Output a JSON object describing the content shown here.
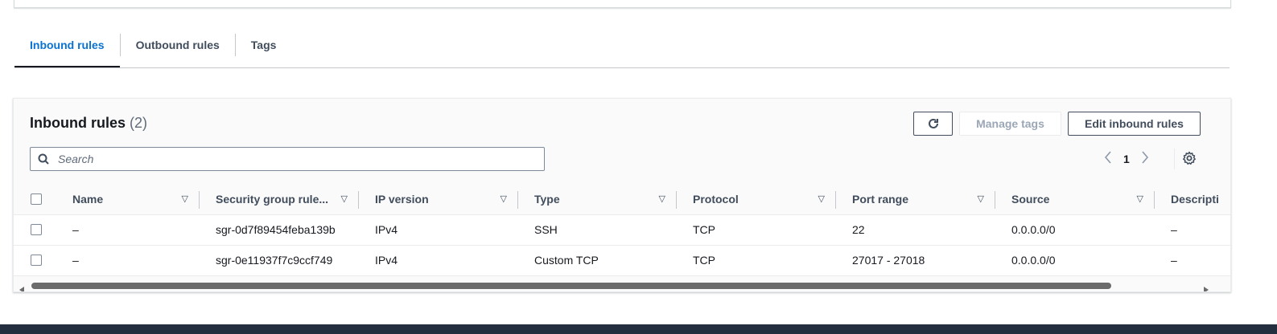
{
  "tabs": [
    {
      "label": "Inbound rules",
      "active": true
    },
    {
      "label": "Outbound rules",
      "active": false
    },
    {
      "label": "Tags",
      "active": false
    }
  ],
  "panel": {
    "title": "Inbound rules",
    "count": "(2)",
    "refresh_icon": "refresh-icon",
    "manage_tags_label": "Manage tags",
    "edit_rules_label": "Edit inbound rules"
  },
  "search": {
    "placeholder": "Search",
    "value": ""
  },
  "pagination": {
    "current_page": "1"
  },
  "table": {
    "columns": [
      "Name",
      "Security group rule...",
      "IP version",
      "Type",
      "Protocol",
      "Port range",
      "Source",
      "Descripti"
    ],
    "rows": [
      {
        "name": "–",
        "rule_id": "sgr-0d7f89454feba139b",
        "ip_version": "IPv4",
        "type": "SSH",
        "protocol": "TCP",
        "port_range": "22",
        "source": "0.0.0.0/0",
        "description": "–"
      },
      {
        "name": "–",
        "rule_id": "sgr-0e11937f7c9ccf749",
        "ip_version": "IPv4",
        "type": "Custom TCP",
        "protocol": "TCP",
        "port_range": "27017 - 27018",
        "source": "0.0.0.0/0",
        "description": "–"
      }
    ]
  },
  "colors": {
    "accent": "#0972d3",
    "text": "#16191f",
    "footer": "#232f3e"
  }
}
